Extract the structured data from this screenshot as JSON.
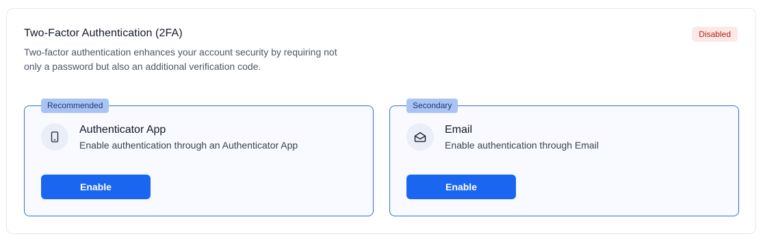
{
  "header": {
    "title": "Two-Factor Authentication (2FA)",
    "description": "Two-factor authentication enhances your account security by requiring not only a password but also an additional verification code.",
    "status": "Disabled"
  },
  "options": [
    {
      "badge": "Recommended",
      "icon": "smartphone-icon",
      "title": "Authenticator App",
      "description": "Enable authentication through an Authenticator App",
      "button_label": "Enable"
    },
    {
      "badge": "Secondary",
      "icon": "envelope-icon",
      "title": "Email",
      "description": "Enable authentication through Email",
      "button_label": "Enable"
    }
  ],
  "colors": {
    "primary": "#1a66f0",
    "border_accent": "#2f6fd6",
    "badge_bg": "#a9c3f2",
    "status_bg": "#fde8e8",
    "status_text": "#b42318"
  }
}
